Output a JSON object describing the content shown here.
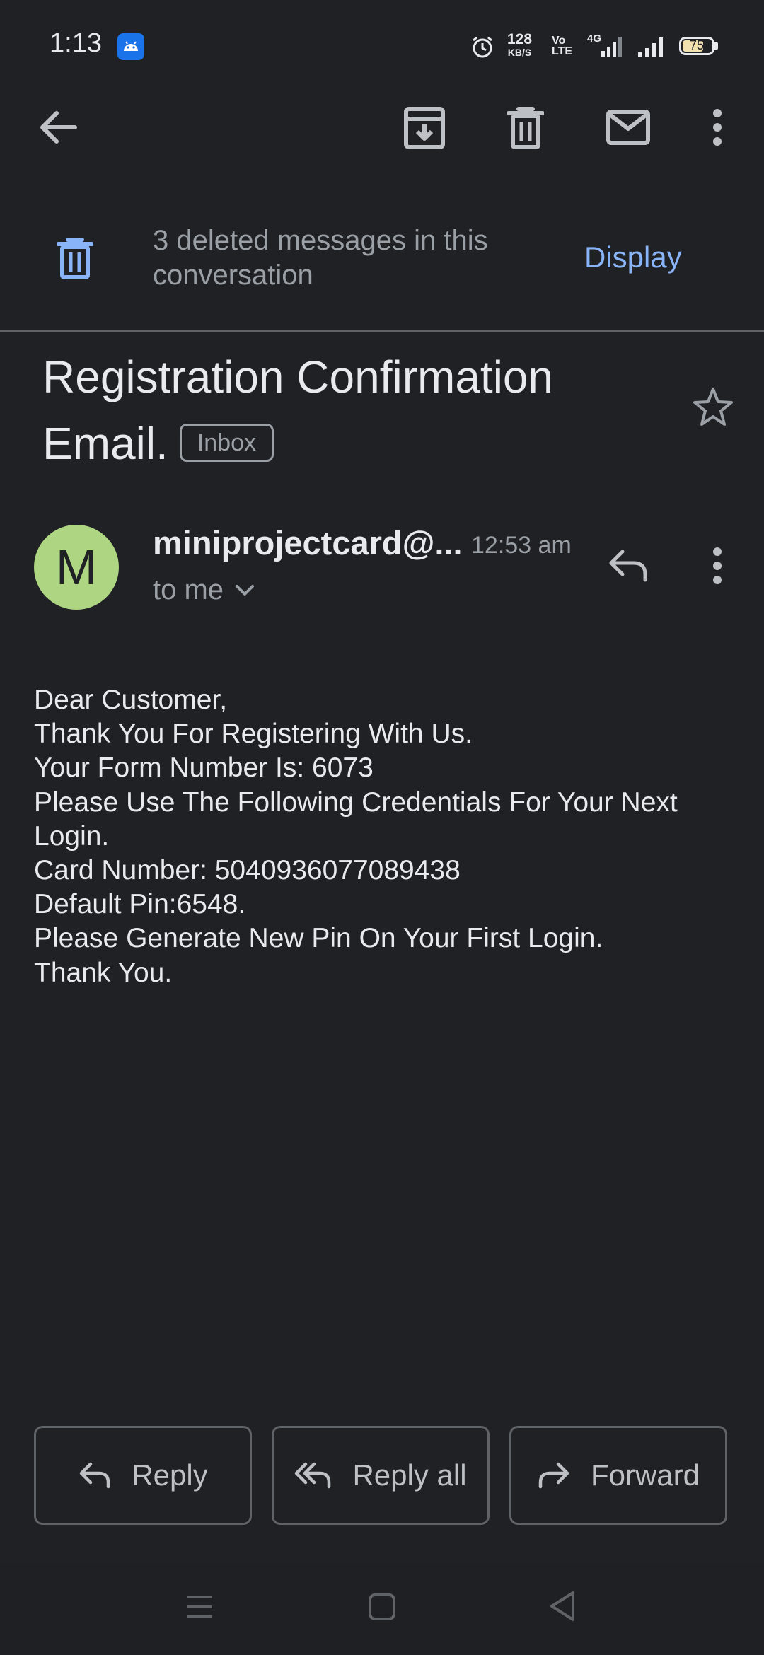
{
  "status_bar": {
    "time": "1:13",
    "net_speed_value": "128",
    "net_speed_unit": "KB/S",
    "volte_top": "Vo",
    "volte_bottom": "LTE",
    "network_type": "4G",
    "battery_level": "75",
    "battery_fraction": 0.75
  },
  "toolbar": {
    "icons": [
      "back-arrow-icon",
      "archive-icon",
      "delete-icon",
      "mark-unread-icon",
      "more-options-icon"
    ]
  },
  "deleted_banner": {
    "message": "3 deleted messages in this conversation",
    "action_label": "Display"
  },
  "subject": {
    "title": "Registration Confirmation Email.",
    "label": "Inbox"
  },
  "sender": {
    "avatar_letter": "M",
    "avatar_color": "#aed581",
    "name": "miniprojectcard@...",
    "time": "12:53 am",
    "recipient": "to me"
  },
  "body": {
    "lines": [
      "Dear Customer,",
      "Thank You For Registering With Us.",
      "Your Form Number Is: 6073",
      "Please Use The Following Credentials For Your Next",
      "Login.",
      "Card Number: 5040936077089438",
      "Default Pin:6548.",
      "Please Generate New Pin On Your First Login.",
      "Thank You."
    ]
  },
  "actions": {
    "reply": "Reply",
    "reply_all": "Reply all",
    "forward": "Forward"
  },
  "colors": {
    "background": "#202124",
    "accent": "#8ab4f8",
    "banner_icon": "#8ab4f8",
    "muted_text": "#9aa0a6"
  }
}
